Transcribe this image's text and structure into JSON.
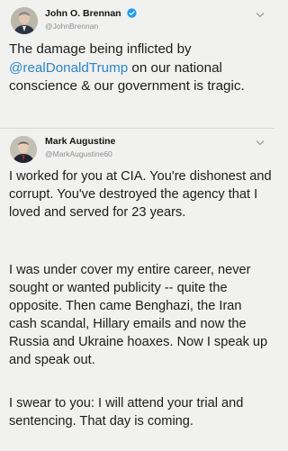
{
  "tweet": {
    "author_name": "John O. Brennan",
    "author_handle": "@JohnBrennan",
    "text_before_mention": "The damage being inflicted by ",
    "mention": "@realDonaldTrump",
    "text_after_mention": " on our national conscience & our government is tragic.",
    "verified_icon": "verified-badge-icon",
    "menu_icon": "chevron-down-icon"
  },
  "reply": {
    "author_name": "Mark Augustine",
    "author_handle": "@MarkAugustine60",
    "paragraphs": [
      "I worked for you at CIA.  You're dishonest and corrupt.  You've destroyed the agency that I loved and served for 23 years.",
      "I was under cover my entire career, never sought or wanted publicity -- quite the opposite.  Then came Benghazi, the Iran cash scandal, Hillary emails and now the Russia and Ukraine hoaxes.  Now I speak up and speak out.",
      "I swear to you: I will attend your trial and sentencing.  That day is coming."
    ],
    "menu_icon": "chevron-down-icon"
  },
  "colors": {
    "mention": "#2a86c9",
    "verified": "#1d9bf0",
    "background": "#f1f1ef"
  }
}
